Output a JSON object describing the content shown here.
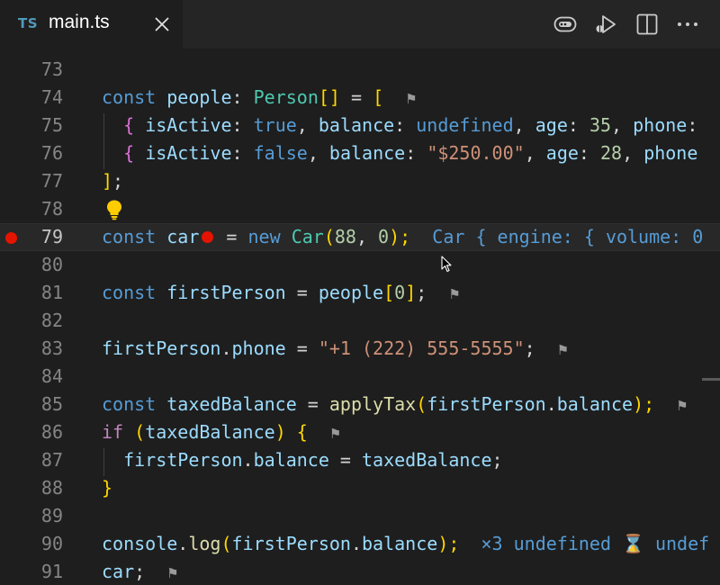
{
  "tab": {
    "lang_badge": "TS",
    "filename": "main.ts"
  },
  "icons": {
    "close": "close-icon",
    "debug": "debug-console-icon",
    "run": "run-debug-icon",
    "split": "split-editor-icon",
    "more": "more-actions-icon",
    "lightbulb": "lightbulb-icon",
    "breakpoint": "breakpoint-icon",
    "flag": "flag-icon"
  },
  "colors": {
    "breakpoint": "#e51400",
    "keyword": "#569cd6",
    "variable": "#9cdcfe",
    "type": "#4ec9b0",
    "function": "#dcdcaa",
    "number": "#b5cea8",
    "string": "#ce9178",
    "lightbulb": "#ffcc00"
  },
  "lines": [
    {
      "num": "73"
    },
    {
      "num": "74",
      "tokens": [
        "const",
        "people",
        ": ",
        "Person",
        "[]",
        " = ",
        "[",
        "⚑"
      ]
    },
    {
      "num": "75",
      "tokens": [
        "{",
        "isActive",
        ": ",
        "true",
        ", ",
        "balance",
        ": ",
        "undefined",
        ", ",
        "age",
        ": ",
        "35",
        ", ",
        "phone",
        ":"
      ]
    },
    {
      "num": "76",
      "tokens": [
        "{",
        "isActive",
        ": ",
        "false",
        ", ",
        "balance",
        ": ",
        "\"$250.00\"",
        ", ",
        "age",
        ": ",
        "28",
        ", ",
        "phone"
      ]
    },
    {
      "num": "77",
      "tokens": [
        "]",
        ";"
      ]
    },
    {
      "num": "78"
    },
    {
      "num": "79",
      "tokens": [
        "const",
        "car",
        " = ",
        "new",
        "Car",
        "(",
        "88",
        ", ",
        "0",
        ");"
      ],
      "hint": "Car { engine: { volume: 0"
    },
    {
      "num": "80"
    },
    {
      "num": "81",
      "tokens": [
        "const",
        "firstPerson",
        " = ",
        "people",
        "[",
        "0",
        "]",
        ";",
        "⚑"
      ]
    },
    {
      "num": "82"
    },
    {
      "num": "83",
      "tokens": [
        "firstPerson",
        ".",
        "phone",
        " = ",
        "\"+1 (222) 555-5555\"",
        ";",
        "⚑"
      ]
    },
    {
      "num": "84"
    },
    {
      "num": "85",
      "tokens": [
        "const",
        "taxedBalance",
        " = ",
        "applyTax",
        "(",
        "firstPerson",
        ".",
        "balance",
        ");",
        "⚑"
      ]
    },
    {
      "num": "86",
      "tokens": [
        "if",
        "(",
        "taxedBalance",
        ")",
        "{",
        "⚑"
      ]
    },
    {
      "num": "87",
      "tokens": [
        "firstPerson",
        ".",
        "balance",
        " = ",
        "taxedBalance",
        ";"
      ]
    },
    {
      "num": "88",
      "tokens": [
        "}"
      ]
    },
    {
      "num": "89"
    },
    {
      "num": "90",
      "tokens": [
        "console",
        ".",
        "log",
        "(",
        "firstPerson",
        ".",
        "balance",
        ");"
      ],
      "hint": "×3 undefined ⌛ undef"
    },
    {
      "num": "91",
      "tokens": [
        "car",
        ";",
        "⚑"
      ]
    }
  ]
}
